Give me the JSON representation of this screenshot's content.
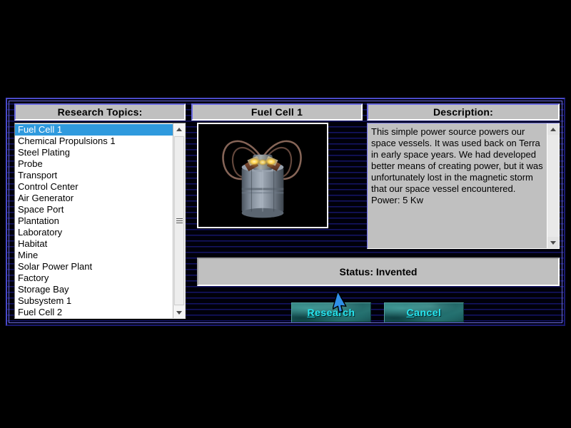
{
  "window": {
    "background_color": "#000000",
    "scanline_color": "#141466",
    "frame_border_color": "#4a4ac8"
  },
  "panels": {
    "topics_header": "Research Topics:",
    "item_header": "Fuel Cell 1",
    "description_header": "Description:"
  },
  "topics_list": {
    "selected_index": 0,
    "items": [
      "Fuel Cell 1",
      "Chemical Propulsions 1",
      "Steel Plating",
      "Probe",
      "Transport",
      "Control Center",
      "Air Generator",
      "Space Port",
      "Plantation",
      "Laboratory",
      "Habitat",
      "Mine",
      "Solar Power Plant",
      "Factory",
      "Storage Bay",
      "Subsystem 1",
      "Fuel Cell 2"
    ]
  },
  "preview": {
    "alt": "fuel-cell-render",
    "background_color": "#000000",
    "body_color": "#8d97a4",
    "coil_color": "#8d6a5c",
    "glow_color": "#ffd34d"
  },
  "description": {
    "text": "This simple power source powers our space vessels.  It was used back on Terra in early space years. We had developed better means of creating power, but it was unfortunately lost in the magnetic storm that our space vessel encountered.  Power: 5 Kw"
  },
  "status": {
    "text": "Status: Invented"
  },
  "buttons": {
    "research": {
      "accel": "R",
      "rest": "esearch"
    },
    "cancel": {
      "accel": "C",
      "rest": "ancel"
    },
    "text_color": "#27e6f0"
  },
  "scrollbars": {
    "up_arrow_icon": "triangle-up-icon",
    "down_arrow_icon": "triangle-down-icon",
    "thumb_grip_icon": "grip-lines-icon"
  },
  "cursor": {
    "icon": "arrow-pointer-icon",
    "color": "#2f8fe8"
  }
}
